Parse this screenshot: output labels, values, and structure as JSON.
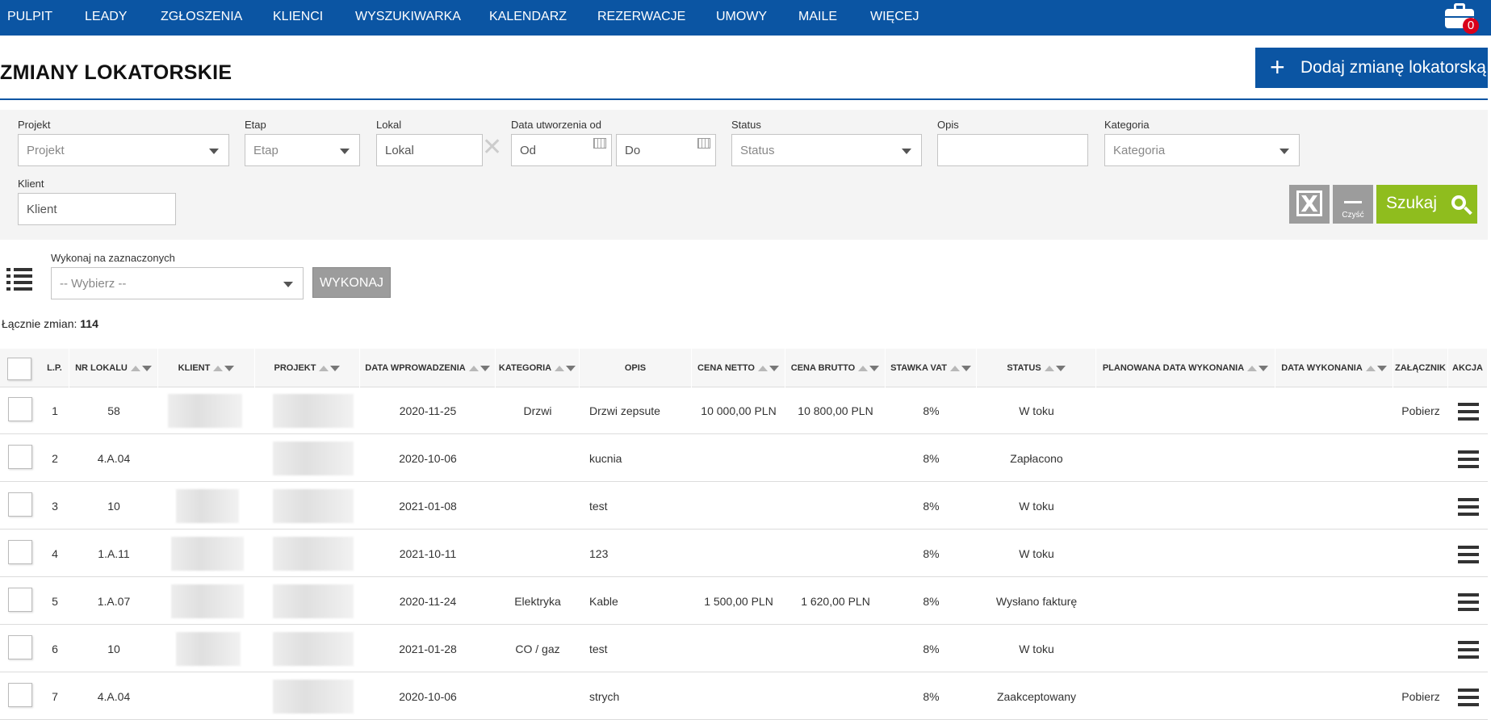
{
  "nav": {
    "items": [
      "PULPIT",
      "LEADY",
      "ZGŁOSZENIA",
      "KLIENCI",
      "WYSZUKIWARKA",
      "KALENDARZ",
      "REZERWACJE",
      "UMOWY",
      "MAILE",
      "WIĘCEJ"
    ],
    "cart_count": "0"
  },
  "page": {
    "title": "ZMIANY LOKATORSKIE",
    "add_button": "Dodaj zmianę lokatorską"
  },
  "filters": {
    "projekt": {
      "label": "Projekt",
      "placeholder": "Projekt"
    },
    "etap": {
      "label": "Etap",
      "placeholder": "Etap"
    },
    "lokal": {
      "label": "Lokal",
      "value": "Lokal"
    },
    "data": {
      "label": "Data utworzenia od",
      "from": "Od",
      "to": "Do"
    },
    "status": {
      "label": "Status",
      "placeholder": "Status"
    },
    "opis": {
      "label": "Opis",
      "value": ""
    },
    "kategoria": {
      "label": "Kategoria",
      "placeholder": "Kategoria"
    },
    "klient": {
      "label": "Klient",
      "value": "Klient"
    },
    "clear_label": "Czyść",
    "search_label": "Szukaj"
  },
  "bulk": {
    "label": "Wykonaj na zaznaczonych",
    "select_placeholder": "-- Wybierz --",
    "execute_label": "WYKONAJ"
  },
  "summary": {
    "label": "Łącznie zmian:",
    "count": "114"
  },
  "table": {
    "columns": [
      "L.P.",
      "NR LOKALU",
      "KLIENT",
      "PROJEKT",
      "DATA WPROWADZENIA",
      "KATEGORIA",
      "OPIS",
      "CENA NETTO",
      "CENA BRUTTO",
      "STAWKA VAT",
      "STATUS",
      "PLANOWANA DATA WYKONANIA",
      "DATA WYKONANIA",
      "ZAŁĄCZNIK",
      "AKCJA"
    ],
    "rows": [
      {
        "lp": "1",
        "lokal": "58",
        "data": "2020-11-25",
        "kategoria": "Drzwi",
        "opis": "Drzwi zepsute",
        "netto": "10 000,00 PLN",
        "brutto": "10 800,00 PLN",
        "vat": "8%",
        "status": "W toku",
        "zalacznik": "Pobierz"
      },
      {
        "lp": "2",
        "lokal": "4.A.04",
        "data": "2020-10-06",
        "kategoria": "",
        "opis": "kucnia",
        "netto": "",
        "brutto": "",
        "vat": "8%",
        "status": "Zapłacono",
        "zalacznik": ""
      },
      {
        "lp": "3",
        "lokal": "10",
        "data": "2021-01-08",
        "kategoria": "",
        "opis": "test",
        "netto": "",
        "brutto": "",
        "vat": "8%",
        "status": "W toku",
        "zalacznik": ""
      },
      {
        "lp": "4",
        "lokal": "1.A.11",
        "data": "2021-10-11",
        "kategoria": "",
        "opis": "123",
        "netto": "",
        "brutto": "",
        "vat": "8%",
        "status": "W toku",
        "zalacznik": ""
      },
      {
        "lp": "5",
        "lokal": "1.A.07",
        "data": "2020-11-24",
        "kategoria": "Elektryka",
        "opis": "Kable",
        "netto": "1 500,00 PLN",
        "brutto": "1 620,00 PLN",
        "vat": "8%",
        "status": "Wysłano fakturę",
        "zalacznik": ""
      },
      {
        "lp": "6",
        "lokal": "10",
        "data": "2021-01-28",
        "kategoria": "CO / gaz",
        "opis": "test",
        "netto": "",
        "brutto": "",
        "vat": "8%",
        "status": "W toku",
        "zalacznik": ""
      },
      {
        "lp": "7",
        "lokal": "4.A.04",
        "data": "2020-10-06",
        "kategoria": "",
        "opis": "strych",
        "netto": "",
        "brutto": "",
        "vat": "8%",
        "status": "Zaakceptowany",
        "zalacznik": "Pobierz"
      }
    ]
  }
}
